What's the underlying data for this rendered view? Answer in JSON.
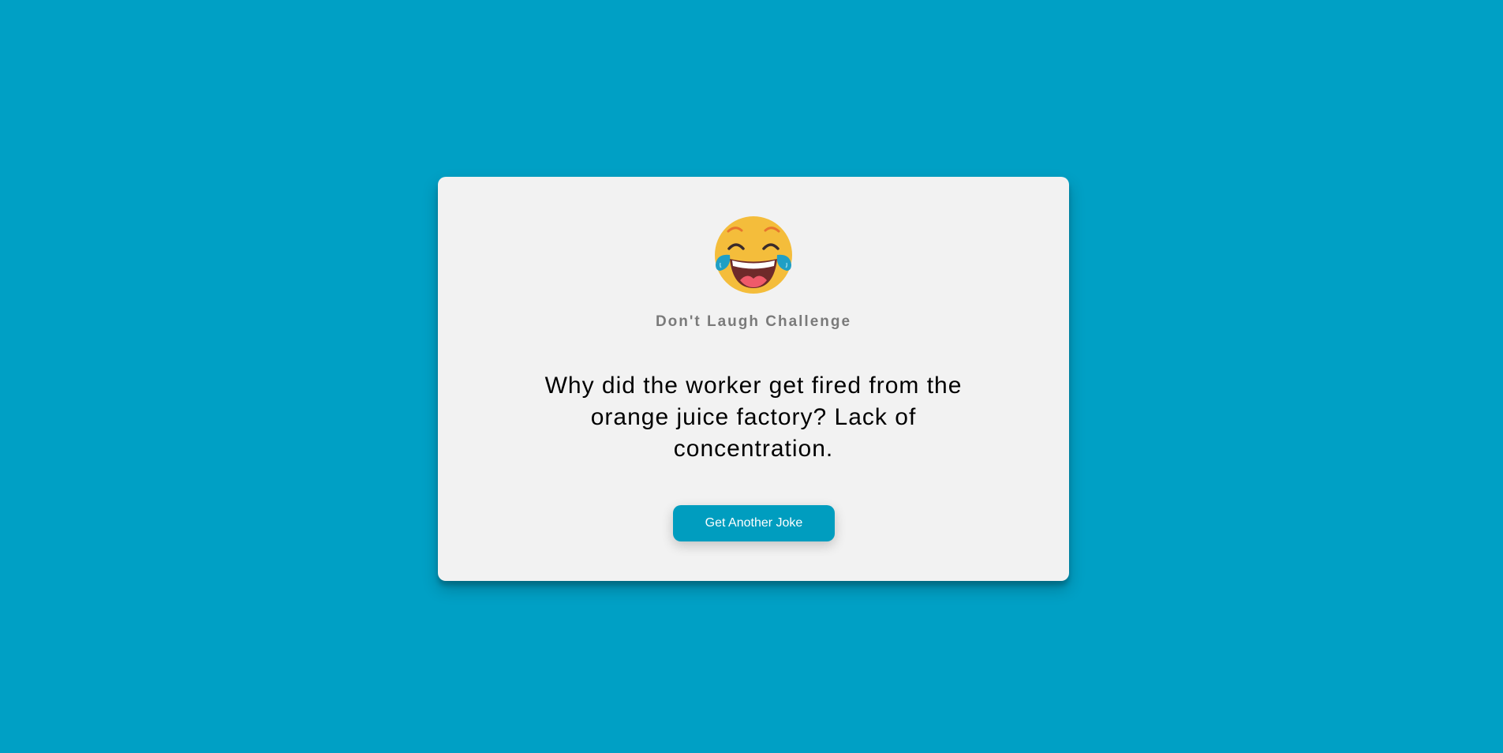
{
  "page": {
    "background_color": "#00a0c5"
  },
  "card": {
    "emoji_icon": "face-with-tears-of-joy-icon",
    "subtitle": "Don't Laugh Challenge",
    "joke": "Why did the worker get fired from the orange juice factory? Lack of concentration.",
    "button_label": "Get Another Joke",
    "button_color": "#009dbf"
  }
}
